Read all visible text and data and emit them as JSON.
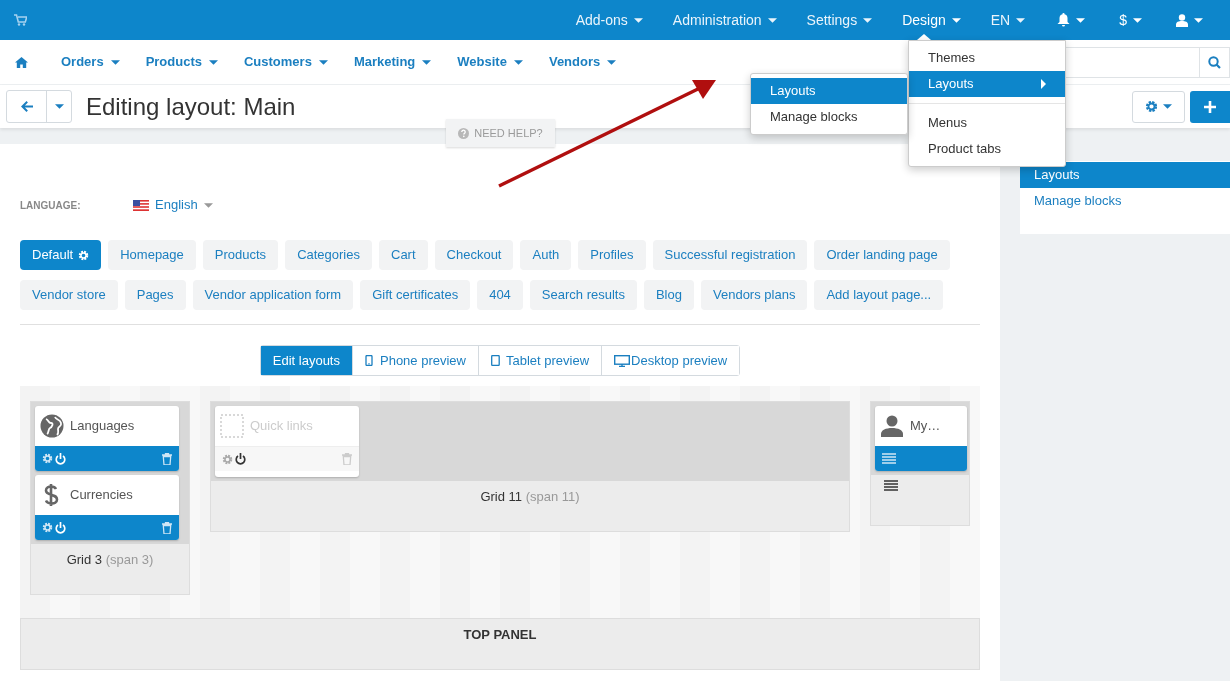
{
  "top_menu": [
    {
      "label": "Add-ons",
      "open": false
    },
    {
      "label": "Administration",
      "open": false
    },
    {
      "label": "Settings",
      "open": false
    },
    {
      "label": "Design",
      "open": true
    },
    {
      "label": "EN",
      "open": false
    }
  ],
  "top_icons": [
    {
      "kind": "bell"
    },
    {
      "kind": "text",
      "label": "$"
    },
    {
      "kind": "user"
    }
  ],
  "main_nav": [
    "Orders",
    "Products",
    "Customers",
    "Marketing",
    "Website",
    "Vendors"
  ],
  "design_menu": {
    "items": [
      {
        "label": "Themes",
        "selected": false,
        "submenu": false
      },
      {
        "label": "Layouts",
        "selected": true,
        "submenu": true
      },
      {
        "kind": "divider"
      },
      {
        "label": "Menus",
        "selected": false,
        "submenu": false
      },
      {
        "label": "Product tabs",
        "selected": false,
        "submenu": false
      }
    ],
    "submenu": [
      {
        "label": "Layouts",
        "selected": true
      },
      {
        "label": "Manage blocks",
        "selected": false
      }
    ]
  },
  "page_title": "Editing layout: Main",
  "need_help": "NEED HELP?",
  "language": {
    "label": "LANGUAGE:",
    "value": "English"
  },
  "layout_pages": [
    {
      "label": "Default",
      "selected": true,
      "kind": "page"
    },
    {
      "label": "Homepage",
      "selected": false,
      "kind": "page"
    },
    {
      "label": "Products",
      "selected": false,
      "kind": "page"
    },
    {
      "label": "Categories",
      "selected": false,
      "kind": "page"
    },
    {
      "label": "Cart",
      "selected": false,
      "kind": "page"
    },
    {
      "label": "Checkout",
      "selected": false,
      "kind": "page"
    },
    {
      "label": "Auth",
      "selected": false,
      "kind": "page"
    },
    {
      "label": "Profiles",
      "selected": false,
      "kind": "page"
    },
    {
      "label": "Successful registration",
      "selected": false,
      "kind": "page"
    },
    {
      "label": "Order landing page",
      "selected": false,
      "kind": "page"
    },
    {
      "label": "Vendor store",
      "selected": false,
      "kind": "page"
    },
    {
      "label": "Pages",
      "selected": false,
      "kind": "page"
    },
    {
      "label": "Vendor application form",
      "selected": false,
      "kind": "page"
    },
    {
      "label": "Gift certificates",
      "selected": false,
      "kind": "page"
    },
    {
      "label": "404",
      "selected": false,
      "kind": "page"
    },
    {
      "label": "Search results",
      "selected": false,
      "kind": "page"
    },
    {
      "label": "Blog",
      "selected": false,
      "kind": "page"
    },
    {
      "label": "Vendors plans",
      "selected": false,
      "kind": "page"
    },
    {
      "label": "Add layout page...",
      "selected": false,
      "kind": "add"
    }
  ],
  "view_tabs": [
    {
      "label": "Edit layouts",
      "selected": true,
      "kind": "none"
    },
    {
      "label": "Phone preview",
      "selected": false,
      "kind": "phone"
    },
    {
      "label": "Tablet preview",
      "selected": false,
      "kind": "tablet"
    },
    {
      "label": "Desktop preview",
      "selected": false,
      "kind": "desktop"
    }
  ],
  "grids": [
    {
      "title": "Grid 3",
      "span": "(span 3)",
      "kind": "narrow",
      "blocks": [
        {
          "title": "Languages",
          "kind": "globe",
          "enabled": true
        },
        {
          "title": "Currencies",
          "kind": "dollar",
          "enabled": true
        }
      ]
    },
    {
      "title": "Grid 11",
      "span": "(span 11)",
      "kind": "wide",
      "blocks": [
        {
          "title": "Quick links",
          "kind": "placeholder",
          "enabled": false
        }
      ]
    },
    {
      "kind": "slim",
      "blocks": [
        {
          "title": "My…",
          "kind": "user",
          "enabled": true,
          "wrapper": true
        }
      ]
    }
  ],
  "top_panel": "TOP PANEL",
  "sidebar": [
    {
      "label": "Layouts",
      "selected": true
    },
    {
      "label": "Manage blocks",
      "selected": false
    }
  ]
}
